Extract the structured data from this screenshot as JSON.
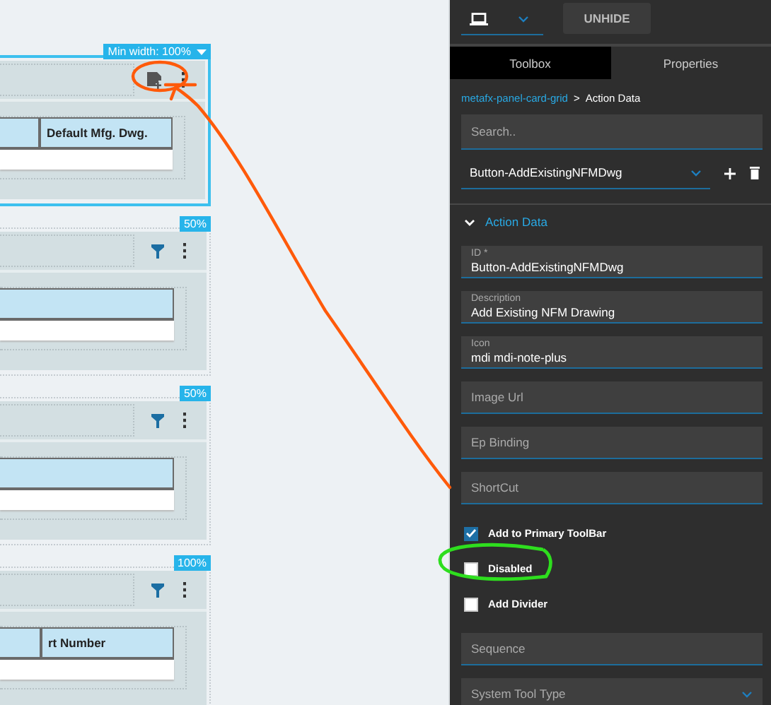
{
  "canvas": {
    "cards": [
      {
        "tag": "Min width: 100%",
        "tag_dropdown": true,
        "selected": true,
        "tools": [
          {
            "kind": "note-plus"
          },
          {
            "kind": "menu"
          }
        ],
        "columns": [
          "Default Mfg. Dwg."
        ]
      },
      {
        "tag": "50%",
        "tag_dropdown": false,
        "selected": false,
        "tools": [
          {
            "kind": "filter"
          },
          {
            "kind": "menu"
          }
        ]
      },
      {
        "tag": "50%",
        "tag_dropdown": false,
        "selected": false,
        "tools": [
          {
            "kind": "filter"
          },
          {
            "kind": "menu"
          }
        ]
      },
      {
        "tag": "100%",
        "tag_dropdown": false,
        "selected": false,
        "tools": [
          {
            "kind": "filter"
          },
          {
            "kind": "menu"
          }
        ],
        "columns": [
          "rt Number"
        ]
      }
    ]
  },
  "panel": {
    "unhide_button": "UNHIDE",
    "tabs": [
      {
        "label": "Toolbox",
        "selected": false
      },
      {
        "label": "Properties",
        "selected": true
      }
    ],
    "breadcrumb": {
      "link": "metafx-panel-card-grid",
      "separator": ">",
      "current": "Action Data"
    },
    "search": {
      "placeholder": "Search.."
    },
    "component_select": {
      "value": "Button-AddExistingNFMDwg"
    },
    "section": {
      "title": "Action Data",
      "expanded": true
    },
    "properties": [
      {
        "kind": "field",
        "label": "ID *",
        "value": "Button-AddExistingNFMDwg"
      },
      {
        "kind": "field",
        "label": "Description",
        "value": "Add Existing NFM Drawing"
      },
      {
        "kind": "field",
        "label": "Icon",
        "value": "mdi mdi-note-plus"
      },
      {
        "kind": "field",
        "placeholder": "Image Url"
      },
      {
        "kind": "field",
        "placeholder": "Ep Binding"
      },
      {
        "kind": "field",
        "placeholder": "ShortCut"
      },
      {
        "kind": "checkbox",
        "label": "Add to Primary ToolBar",
        "checked": true
      },
      {
        "kind": "checkbox",
        "label": "Disabled",
        "checked": false
      },
      {
        "kind": "checkbox",
        "label": "Add Divider",
        "checked": false
      },
      {
        "kind": "field",
        "placeholder": "Sequence"
      },
      {
        "kind": "select",
        "placeholder": "System Tool Type"
      }
    ]
  }
}
